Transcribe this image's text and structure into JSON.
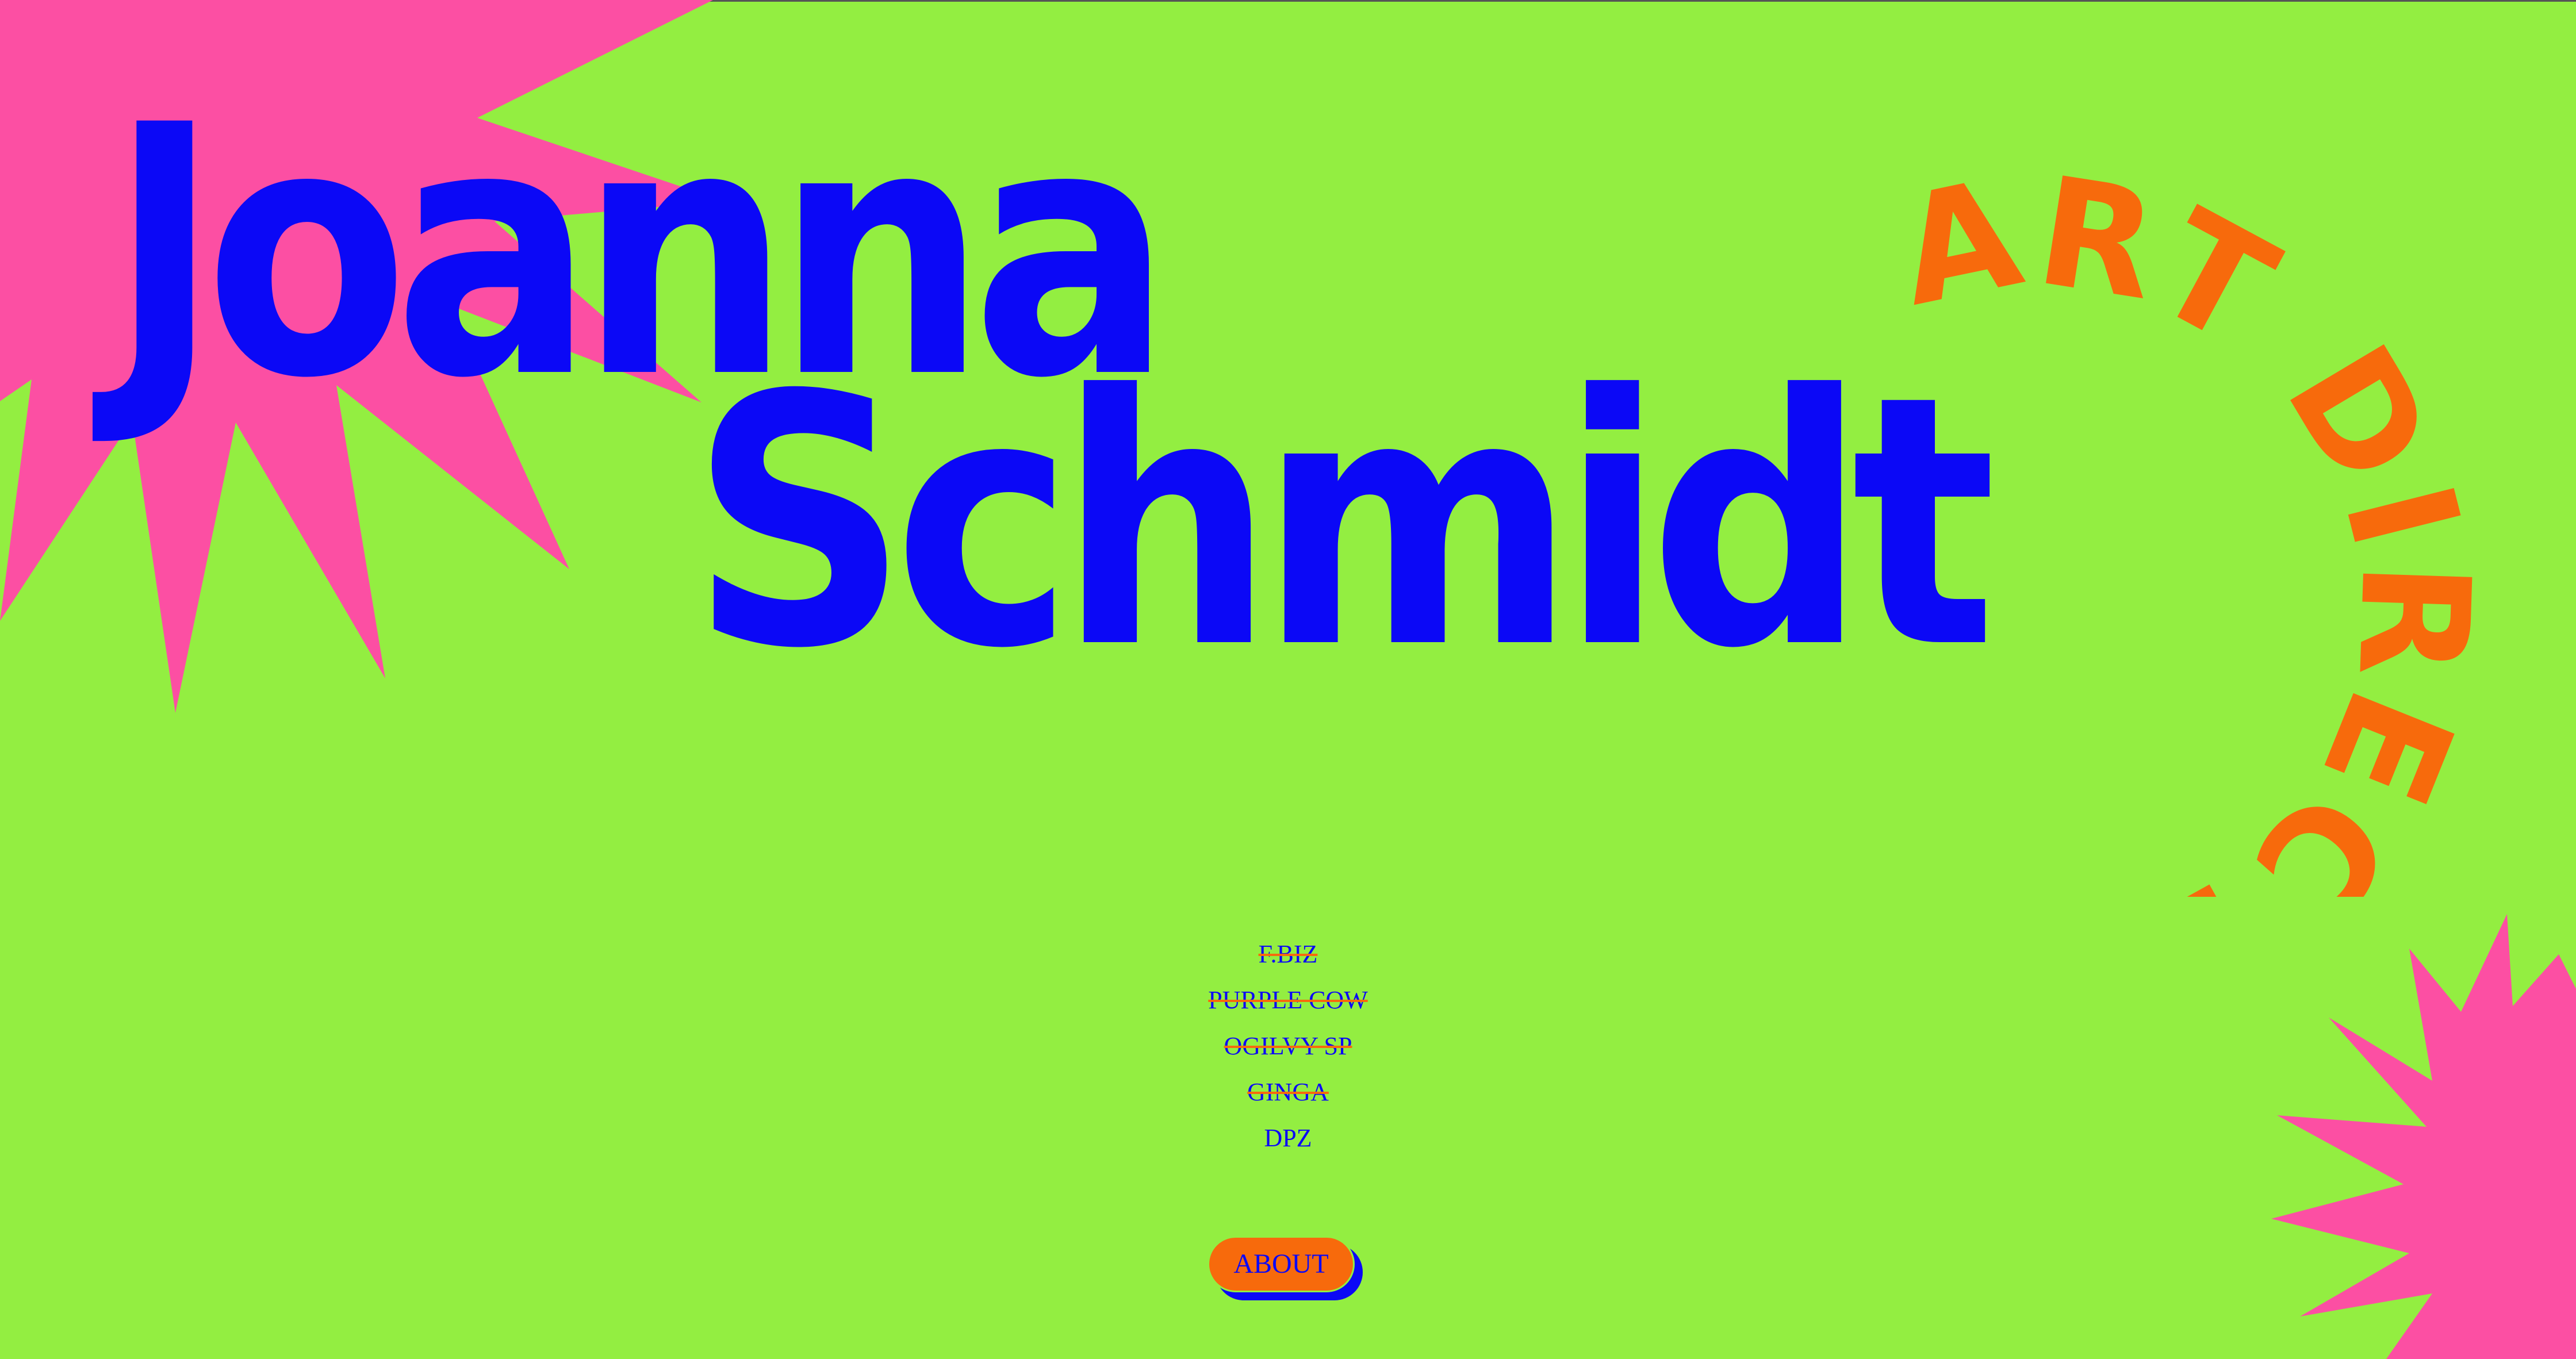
{
  "colors": {
    "background": "#93ee41",
    "name_blue": "#0b08f6",
    "accent_orange": "#f76a0c",
    "starburst_pink": "#fc4fa3"
  },
  "name": {
    "first": "Joanna",
    "last": "Schmidt"
  },
  "role": "ART DIRECTOR",
  "agencies": [
    {
      "label": "F.BIZ",
      "struck": true
    },
    {
      "label": "PURPLE COW",
      "struck": true
    },
    {
      "label": "OGILVY SP",
      "struck": true
    },
    {
      "label": "GINGA",
      "struck": true
    },
    {
      "label": "DPZ",
      "struck": false
    }
  ],
  "about_button": {
    "label": "ABOUT"
  }
}
